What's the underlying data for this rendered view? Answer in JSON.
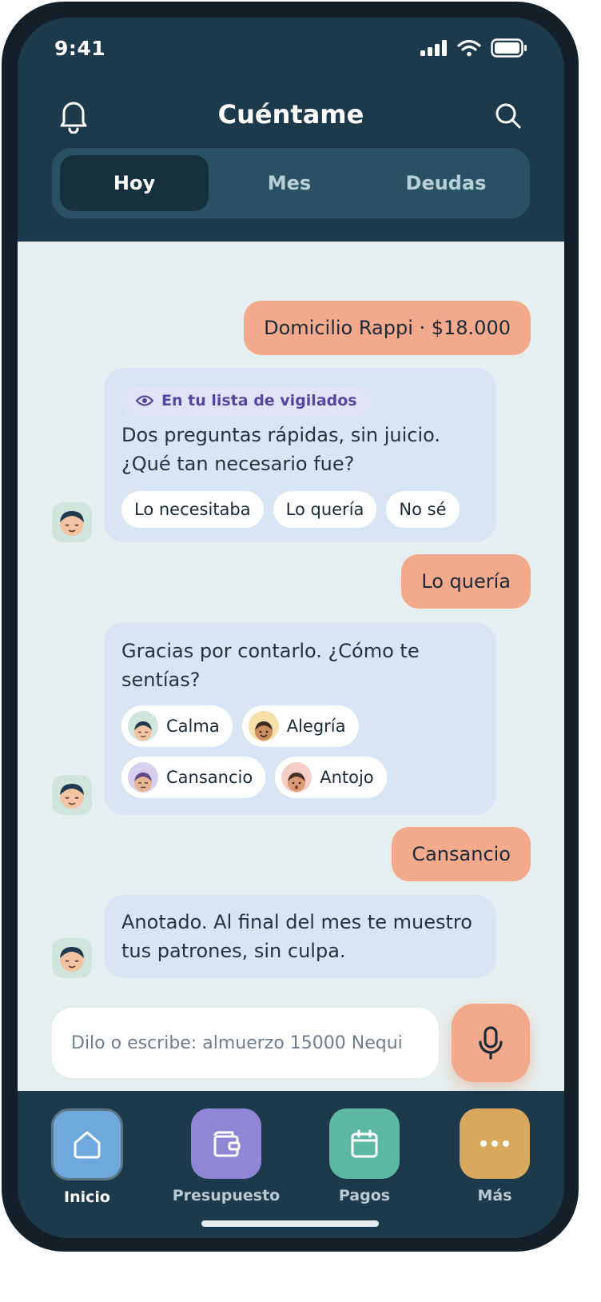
{
  "status_bar": {
    "time": "9:41"
  },
  "header": {
    "title": "Cuéntame",
    "left_icon": "bell-icon",
    "right_icon": "search-icon"
  },
  "tabs": [
    {
      "label": "Hoy",
      "active": true
    },
    {
      "label": "Mes",
      "active": false
    },
    {
      "label": "Deudas",
      "active": false
    }
  ],
  "chat": {
    "user_msg_1": "Domicilio Rappi · $18.000",
    "bot_msg_1": {
      "tag": "En tu lista de vigilados",
      "text": "Dos preguntas rápidas, sin juicio. ¿Qué tan necesario fue?",
      "options": [
        "Lo necesitaba",
        "Lo quería",
        "No sé"
      ]
    },
    "user_msg_2": "Lo quería",
    "bot_msg_2": {
      "text": "Gracias por contarlo. ¿Cómo te sentías?",
      "options": [
        "Calma",
        "Alegría",
        "Cansancio",
        "Antojo"
      ]
    },
    "user_msg_3": "Cansancio",
    "bot_msg_3": {
      "text": "Anotado. Al final del mes te muestro tus patrones, sin culpa."
    }
  },
  "composer": {
    "placeholder": "Dilo o escribe: almuerzo 15000 Nequi",
    "mic_icon": "microphone-icon"
  },
  "bottom_nav": [
    {
      "label": "Inicio",
      "icon": "home-icon",
      "color": "#6ea8dc",
      "active": true
    },
    {
      "label": "Presupuesto",
      "icon": "wallet-icon",
      "color": "#8f86d6",
      "active": false
    },
    {
      "label": "Pagos",
      "icon": "calendar-icon",
      "color": "#5cb8a3",
      "active": false
    },
    {
      "label": "Más",
      "icon": "more-icon",
      "color": "#d8a85e",
      "active": false
    }
  ],
  "colors": {
    "header_bg": "#1d3a4c",
    "chat_bg": "#e6efef",
    "user_bubble": "#f2a98c",
    "bot_bubble": "#d7e5f4"
  }
}
